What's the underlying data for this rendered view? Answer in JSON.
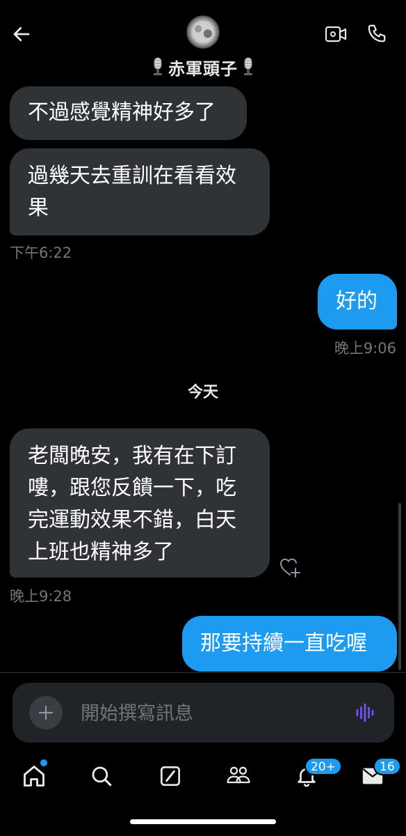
{
  "header": {
    "contact_name": "赤軍頭子",
    "back_icon": "arrow-left-icon",
    "video_icon": "video-call-icon",
    "phone_icon": "phone-icon",
    "name_decoration_icon": "microphone-emoji"
  },
  "messages": [
    {
      "direction": "in",
      "text": "不過感覺精神好多了"
    },
    {
      "direction": "in",
      "lines": [
        "過幾天去重訓在看看效",
        "果"
      ],
      "timestamp": "下午6:22"
    },
    {
      "direction": "out",
      "text": "好的",
      "timestamp": "晚上9:06"
    },
    {
      "direction": "in",
      "lines": [
        "老闆晚安，我有在下訂",
        "嘍，跟您反饋一下，吃",
        "完運動效果不錯，白天",
        "上班也精神多了"
      ],
      "timestamp": "晚上9:28"
    },
    {
      "direction": "out",
      "text": "那要持續一直吃喔"
    }
  ],
  "day_separator": "今天",
  "composer": {
    "placeholder": "開始撰寫訊息",
    "add_icon": "plus-icon",
    "voice_icon": "voice-wave-icon"
  },
  "tabbar": {
    "items": [
      {
        "name": "home",
        "icon": "home-icon",
        "has_dot": true
      },
      {
        "name": "search",
        "icon": "search-icon"
      },
      {
        "name": "grok",
        "icon": "slash-square-icon"
      },
      {
        "name": "communities",
        "icon": "people-icon"
      },
      {
        "name": "notifications",
        "icon": "bell-icon",
        "badge": "20+"
      },
      {
        "name": "messages",
        "icon": "envelope-icon",
        "badge": "16"
      }
    ]
  },
  "colors": {
    "accent": "#1d9bf0",
    "incoming_bubble": "#2f3336",
    "background": "#000000",
    "timestamp": "#71767b",
    "voice_icon": "#7856ff"
  }
}
